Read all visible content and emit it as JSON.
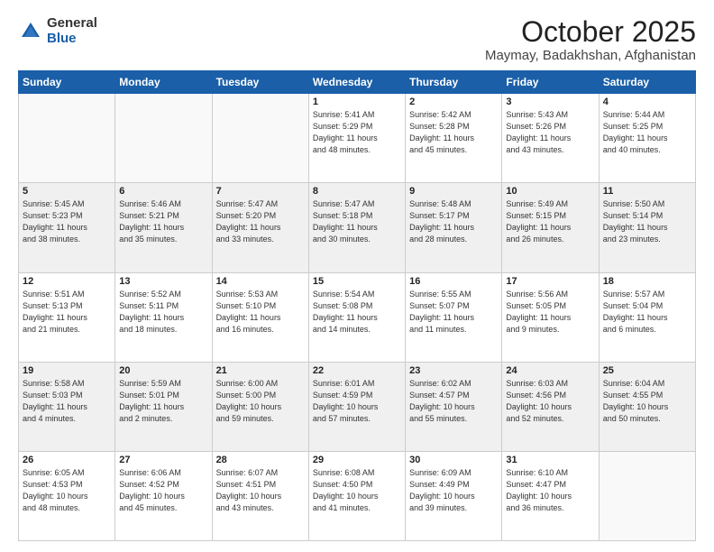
{
  "header": {
    "logo_general": "General",
    "logo_blue": "Blue",
    "month": "October 2025",
    "location": "Maymay, Badakhshan, Afghanistan"
  },
  "weekdays": [
    "Sunday",
    "Monday",
    "Tuesday",
    "Wednesday",
    "Thursday",
    "Friday",
    "Saturday"
  ],
  "weeks": [
    {
      "shaded": false,
      "days": [
        {
          "num": "",
          "info": ""
        },
        {
          "num": "",
          "info": ""
        },
        {
          "num": "",
          "info": ""
        },
        {
          "num": "1",
          "info": "Sunrise: 5:41 AM\nSunset: 5:29 PM\nDaylight: 11 hours\nand 48 minutes."
        },
        {
          "num": "2",
          "info": "Sunrise: 5:42 AM\nSunset: 5:28 PM\nDaylight: 11 hours\nand 45 minutes."
        },
        {
          "num": "3",
          "info": "Sunrise: 5:43 AM\nSunset: 5:26 PM\nDaylight: 11 hours\nand 43 minutes."
        },
        {
          "num": "4",
          "info": "Sunrise: 5:44 AM\nSunset: 5:25 PM\nDaylight: 11 hours\nand 40 minutes."
        }
      ]
    },
    {
      "shaded": true,
      "days": [
        {
          "num": "5",
          "info": "Sunrise: 5:45 AM\nSunset: 5:23 PM\nDaylight: 11 hours\nand 38 minutes."
        },
        {
          "num": "6",
          "info": "Sunrise: 5:46 AM\nSunset: 5:21 PM\nDaylight: 11 hours\nand 35 minutes."
        },
        {
          "num": "7",
          "info": "Sunrise: 5:47 AM\nSunset: 5:20 PM\nDaylight: 11 hours\nand 33 minutes."
        },
        {
          "num": "8",
          "info": "Sunrise: 5:47 AM\nSunset: 5:18 PM\nDaylight: 11 hours\nand 30 minutes."
        },
        {
          "num": "9",
          "info": "Sunrise: 5:48 AM\nSunset: 5:17 PM\nDaylight: 11 hours\nand 28 minutes."
        },
        {
          "num": "10",
          "info": "Sunrise: 5:49 AM\nSunset: 5:15 PM\nDaylight: 11 hours\nand 26 minutes."
        },
        {
          "num": "11",
          "info": "Sunrise: 5:50 AM\nSunset: 5:14 PM\nDaylight: 11 hours\nand 23 minutes."
        }
      ]
    },
    {
      "shaded": false,
      "days": [
        {
          "num": "12",
          "info": "Sunrise: 5:51 AM\nSunset: 5:13 PM\nDaylight: 11 hours\nand 21 minutes."
        },
        {
          "num": "13",
          "info": "Sunrise: 5:52 AM\nSunset: 5:11 PM\nDaylight: 11 hours\nand 18 minutes."
        },
        {
          "num": "14",
          "info": "Sunrise: 5:53 AM\nSunset: 5:10 PM\nDaylight: 11 hours\nand 16 minutes."
        },
        {
          "num": "15",
          "info": "Sunrise: 5:54 AM\nSunset: 5:08 PM\nDaylight: 11 hours\nand 14 minutes."
        },
        {
          "num": "16",
          "info": "Sunrise: 5:55 AM\nSunset: 5:07 PM\nDaylight: 11 hours\nand 11 minutes."
        },
        {
          "num": "17",
          "info": "Sunrise: 5:56 AM\nSunset: 5:05 PM\nDaylight: 11 hours\nand 9 minutes."
        },
        {
          "num": "18",
          "info": "Sunrise: 5:57 AM\nSunset: 5:04 PM\nDaylight: 11 hours\nand 6 minutes."
        }
      ]
    },
    {
      "shaded": true,
      "days": [
        {
          "num": "19",
          "info": "Sunrise: 5:58 AM\nSunset: 5:03 PM\nDaylight: 11 hours\nand 4 minutes."
        },
        {
          "num": "20",
          "info": "Sunrise: 5:59 AM\nSunset: 5:01 PM\nDaylight: 11 hours\nand 2 minutes."
        },
        {
          "num": "21",
          "info": "Sunrise: 6:00 AM\nSunset: 5:00 PM\nDaylight: 10 hours\nand 59 minutes."
        },
        {
          "num": "22",
          "info": "Sunrise: 6:01 AM\nSunset: 4:59 PM\nDaylight: 10 hours\nand 57 minutes."
        },
        {
          "num": "23",
          "info": "Sunrise: 6:02 AM\nSunset: 4:57 PM\nDaylight: 10 hours\nand 55 minutes."
        },
        {
          "num": "24",
          "info": "Sunrise: 6:03 AM\nSunset: 4:56 PM\nDaylight: 10 hours\nand 52 minutes."
        },
        {
          "num": "25",
          "info": "Sunrise: 6:04 AM\nSunset: 4:55 PM\nDaylight: 10 hours\nand 50 minutes."
        }
      ]
    },
    {
      "shaded": false,
      "days": [
        {
          "num": "26",
          "info": "Sunrise: 6:05 AM\nSunset: 4:53 PM\nDaylight: 10 hours\nand 48 minutes."
        },
        {
          "num": "27",
          "info": "Sunrise: 6:06 AM\nSunset: 4:52 PM\nDaylight: 10 hours\nand 45 minutes."
        },
        {
          "num": "28",
          "info": "Sunrise: 6:07 AM\nSunset: 4:51 PM\nDaylight: 10 hours\nand 43 minutes."
        },
        {
          "num": "29",
          "info": "Sunrise: 6:08 AM\nSunset: 4:50 PM\nDaylight: 10 hours\nand 41 minutes."
        },
        {
          "num": "30",
          "info": "Sunrise: 6:09 AM\nSunset: 4:49 PM\nDaylight: 10 hours\nand 39 minutes."
        },
        {
          "num": "31",
          "info": "Sunrise: 6:10 AM\nSunset: 4:47 PM\nDaylight: 10 hours\nand 36 minutes."
        },
        {
          "num": "",
          "info": ""
        }
      ]
    }
  ]
}
